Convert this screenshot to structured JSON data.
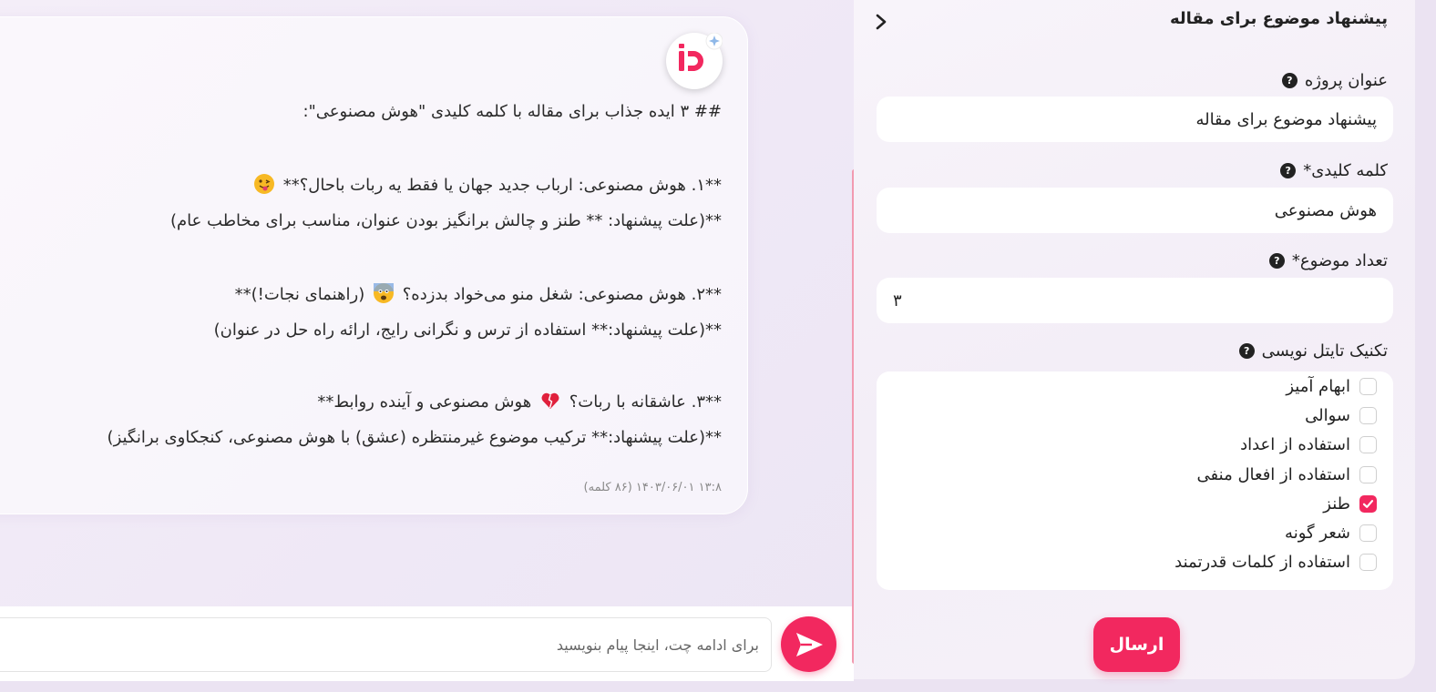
{
  "chat": {
    "lines": [
      "## ۳ ایده جذاب برای مقاله با کلمه کلیدی \"هوش مصنوعی\":",
      "**۱. هوش مصنوعی: ارباب جدید جهان یا فقط یه ربات باحال؟**",
      "**(علت پیشنهاد: ** طنز و چالش برانگیز بودن عنوان، مناسب برای مخاطب عام)",
      "**۲. هوش مصنوعی: شغل منو می‌خواد بدزده؟",
      "(راهنمای نجات!)**",
      "**(علت پیشنهاد:** استفاده از ترس و نگرانی رایج، ارائه راه حل در عنوان)",
      "**۳. عاشقانه با ربات؟",
      "هوش مصنوعی و آینده روابط**",
      "**(علت پیشنهاد:** ترکیب موضوع غیرمنتظره (عشق) با هوش مصنوعی، کنجکاوی برانگیز)"
    ],
    "meta": "۱۳:۸ ۱۴۰۳/۰۶/۰۱ (۸۶ کلمه)",
    "emoji_colors": {
      "tongue": "#f7b924",
      "fear": "#f7b924",
      "heart": "#e0203c"
    },
    "accent": "#f2285f"
  },
  "composer": {
    "placeholder": "برای ادامه چت، اینجا پیام بنویسید"
  },
  "panel": {
    "title": "پیشنهاد موضوع برای مقاله",
    "help_glyph": "?",
    "fields": {
      "project_title": {
        "label": "عنوان پروژه",
        "value": "پیشنهاد موضوع برای مقاله"
      },
      "keyword": {
        "label": "کلمه کلیدی*",
        "value": "هوش مصنوعی"
      },
      "count": {
        "label": "تعداد موضوع*",
        "value": "۳"
      }
    },
    "technique": {
      "label": "تکنیک تایتل نویسی",
      "options": [
        {
          "label": "ابهام آمیز",
          "checked": false
        },
        {
          "label": "سوالی",
          "checked": false
        },
        {
          "label": "استفاده از اعداد",
          "checked": false
        },
        {
          "label": "استفاده از افعال منفی",
          "checked": false
        },
        {
          "label": "طنز",
          "checked": true
        },
        {
          "label": "شعر گونه",
          "checked": false
        },
        {
          "label": "استفاده از کلمات قدرتمند",
          "checked": false
        }
      ]
    },
    "submit_label": "ارسال"
  }
}
